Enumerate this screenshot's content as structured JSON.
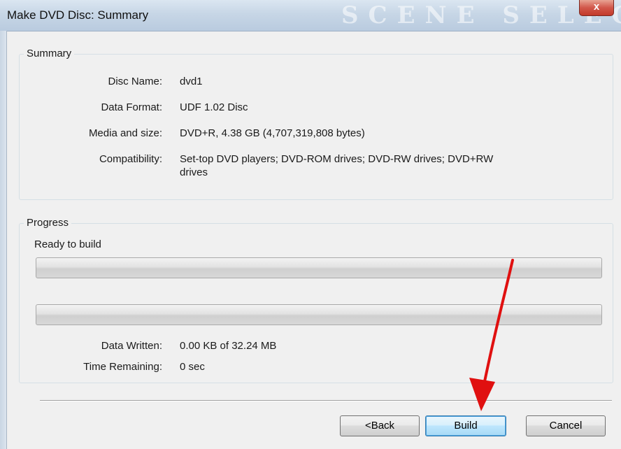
{
  "window": {
    "title": "Make DVD Disc: Summary",
    "watermark": "SCENE SELEC",
    "close_glyph": "x"
  },
  "summary": {
    "legend": "Summary",
    "rows": [
      {
        "label": "Disc Name:",
        "value": "dvd1"
      },
      {
        "label": "Data Format:",
        "value": "UDF 1.02 Disc"
      },
      {
        "label": "Media and size:",
        "value": "DVD+R, 4.38 GB (4,707,319,808 bytes)"
      },
      {
        "label": "Compatibility:",
        "value_line1": "Set-top DVD players; DVD-ROM drives; DVD-RW drives; DVD+RW",
        "value_line2": "drives"
      }
    ]
  },
  "progress": {
    "legend": "Progress",
    "status": "Ready to build",
    "bar1_fraction": 0,
    "bar2_fraction": 0,
    "data_written_label": "Data Written:",
    "data_written_value": "0.00 KB of 32.24 MB",
    "time_remaining_label": "Time Remaining:",
    "time_remaining_value": "0 sec"
  },
  "buttons": {
    "back": "<Back",
    "build": "Build",
    "cancel": "Cancel"
  },
  "colors": {
    "annotation_arrow": "#e01010",
    "progress_fill": "#37b34a"
  }
}
